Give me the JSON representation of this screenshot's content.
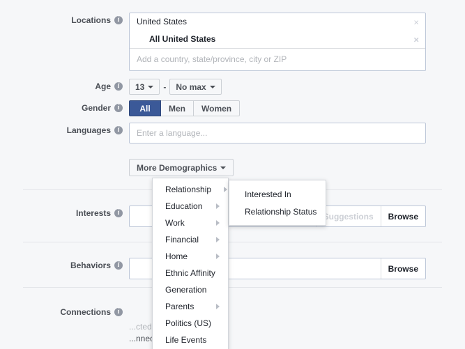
{
  "colors": {
    "page_bg": "#f6f7f9",
    "accent_blue": "#3b5998",
    "label_text": "#4b4f56",
    "placeholder": "#b1b4b9",
    "border": "#bdc7d8"
  },
  "rows": {
    "locations": {
      "label": "Locations",
      "tokens": [
        {
          "text": "United States",
          "sub": false,
          "remove": "×"
        },
        {
          "text": "All United States",
          "sub": true,
          "remove": "×"
        }
      ],
      "placeholder": "Add a country, state/province, city or ZIP"
    },
    "age": {
      "label": "Age",
      "min_value": "13",
      "separator": "-",
      "max_value": "No max"
    },
    "gender": {
      "label": "Gender",
      "options": [
        "All",
        "Men",
        "Women"
      ],
      "selected": "All"
    },
    "languages": {
      "label": "Languages",
      "placeholder": "Enter a language..."
    },
    "more_demographics": {
      "label": "More Demographics"
    },
    "interests": {
      "label": "Interests",
      "placeholder": "",
      "suggestions_label": "Suggestions",
      "browse_label": "Browse"
    },
    "behaviors": {
      "label": "Behaviors",
      "placeholder": "",
      "browse_label": "Browse"
    },
    "connections": {
      "label": "Connections",
      "line_muted": "...cted to The Quire",
      "line_dark": "...nnected to The Quire"
    }
  },
  "demographics_menu": {
    "items": [
      {
        "label": "Relationship",
        "has_submenu": true
      },
      {
        "label": "Education",
        "has_submenu": true
      },
      {
        "label": "Work",
        "has_submenu": true
      },
      {
        "label": "Financial",
        "has_submenu": true
      },
      {
        "label": "Home",
        "has_submenu": true
      },
      {
        "label": "Ethnic Affinity",
        "has_submenu": false
      },
      {
        "label": "Generation",
        "has_submenu": false
      },
      {
        "label": "Parents",
        "has_submenu": true
      },
      {
        "label": "Politics (US)",
        "has_submenu": false
      },
      {
        "label": "Life Events",
        "has_submenu": false
      }
    ]
  },
  "relationship_submenu": {
    "parent": "Relationship",
    "items": [
      {
        "label": "Interested In"
      },
      {
        "label": "Relationship Status"
      }
    ]
  }
}
